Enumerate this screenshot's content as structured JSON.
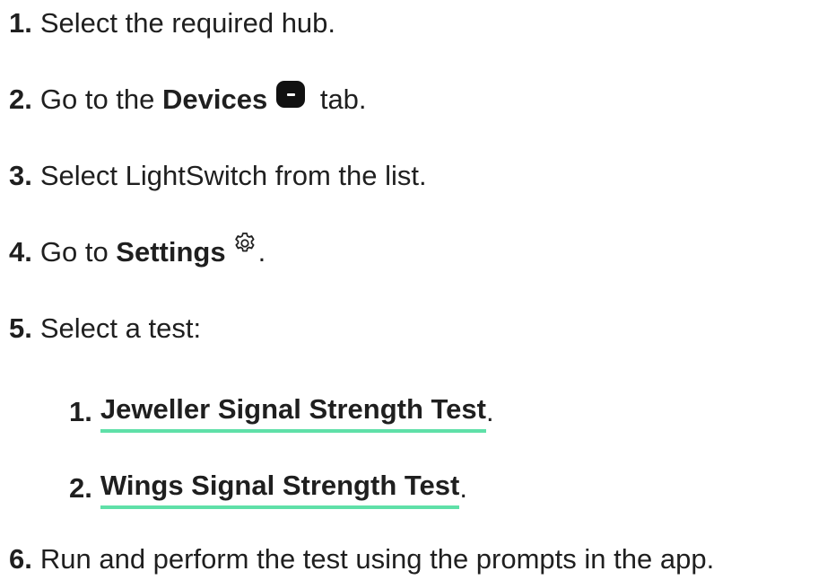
{
  "steps": [
    {
      "num": "1.",
      "text": "Select the required hub."
    },
    {
      "num": "2.",
      "pre": "Go to the ",
      "bold": "Devices",
      "post": " tab.",
      "icon": "devices-tab-icon"
    },
    {
      "num": "3.",
      "text": "Select LightSwitch from the list."
    },
    {
      "num": "4.",
      "pre": "Go to ",
      "bold": "Settings",
      "post": ".",
      "icon": "gear-icon"
    },
    {
      "num": "5.",
      "text": "Select a test:"
    },
    {
      "num": "6.",
      "text": "Run and perform the test using the prompts in the app."
    }
  ],
  "substeps": [
    {
      "num": "1.",
      "link": "Jeweller Signal Strength Test",
      "post": "."
    },
    {
      "num": "2.",
      "link": "Wings Signal Strength Test",
      "post": "."
    }
  ],
  "colors": {
    "text": "#1f1f1f",
    "link_underline": "#5fe0a8",
    "icon_bg": "#111111"
  }
}
